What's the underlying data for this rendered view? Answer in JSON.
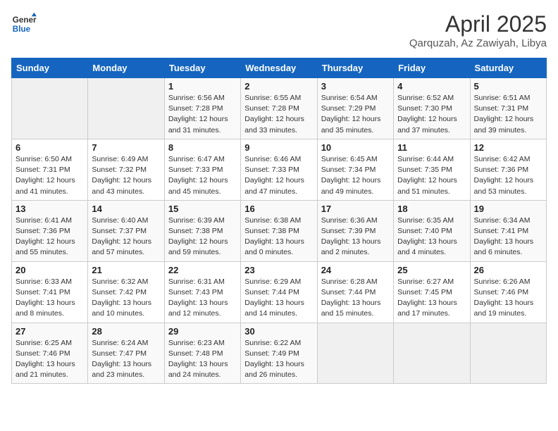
{
  "header": {
    "logo_general": "General",
    "logo_blue": "Blue",
    "title": "April 2025",
    "location": "Qarquzah, Az Zawiyah, Libya"
  },
  "days_of_week": [
    "Sunday",
    "Monday",
    "Tuesday",
    "Wednesday",
    "Thursday",
    "Friday",
    "Saturday"
  ],
  "weeks": [
    [
      {
        "day": "",
        "info": ""
      },
      {
        "day": "",
        "info": ""
      },
      {
        "day": "1",
        "info": "Sunrise: 6:56 AM\nSunset: 7:28 PM\nDaylight: 12 hours and 31 minutes."
      },
      {
        "day": "2",
        "info": "Sunrise: 6:55 AM\nSunset: 7:28 PM\nDaylight: 12 hours and 33 minutes."
      },
      {
        "day": "3",
        "info": "Sunrise: 6:54 AM\nSunset: 7:29 PM\nDaylight: 12 hours and 35 minutes."
      },
      {
        "day": "4",
        "info": "Sunrise: 6:52 AM\nSunset: 7:30 PM\nDaylight: 12 hours and 37 minutes."
      },
      {
        "day": "5",
        "info": "Sunrise: 6:51 AM\nSunset: 7:31 PM\nDaylight: 12 hours and 39 minutes."
      }
    ],
    [
      {
        "day": "6",
        "info": "Sunrise: 6:50 AM\nSunset: 7:31 PM\nDaylight: 12 hours and 41 minutes."
      },
      {
        "day": "7",
        "info": "Sunrise: 6:49 AM\nSunset: 7:32 PM\nDaylight: 12 hours and 43 minutes."
      },
      {
        "day": "8",
        "info": "Sunrise: 6:47 AM\nSunset: 7:33 PM\nDaylight: 12 hours and 45 minutes."
      },
      {
        "day": "9",
        "info": "Sunrise: 6:46 AM\nSunset: 7:33 PM\nDaylight: 12 hours and 47 minutes."
      },
      {
        "day": "10",
        "info": "Sunrise: 6:45 AM\nSunset: 7:34 PM\nDaylight: 12 hours and 49 minutes."
      },
      {
        "day": "11",
        "info": "Sunrise: 6:44 AM\nSunset: 7:35 PM\nDaylight: 12 hours and 51 minutes."
      },
      {
        "day": "12",
        "info": "Sunrise: 6:42 AM\nSunset: 7:36 PM\nDaylight: 12 hours and 53 minutes."
      }
    ],
    [
      {
        "day": "13",
        "info": "Sunrise: 6:41 AM\nSunset: 7:36 PM\nDaylight: 12 hours and 55 minutes."
      },
      {
        "day": "14",
        "info": "Sunrise: 6:40 AM\nSunset: 7:37 PM\nDaylight: 12 hours and 57 minutes."
      },
      {
        "day": "15",
        "info": "Sunrise: 6:39 AM\nSunset: 7:38 PM\nDaylight: 12 hours and 59 minutes."
      },
      {
        "day": "16",
        "info": "Sunrise: 6:38 AM\nSunset: 7:38 PM\nDaylight: 13 hours and 0 minutes."
      },
      {
        "day": "17",
        "info": "Sunrise: 6:36 AM\nSunset: 7:39 PM\nDaylight: 13 hours and 2 minutes."
      },
      {
        "day": "18",
        "info": "Sunrise: 6:35 AM\nSunset: 7:40 PM\nDaylight: 13 hours and 4 minutes."
      },
      {
        "day": "19",
        "info": "Sunrise: 6:34 AM\nSunset: 7:41 PM\nDaylight: 13 hours and 6 minutes."
      }
    ],
    [
      {
        "day": "20",
        "info": "Sunrise: 6:33 AM\nSunset: 7:41 PM\nDaylight: 13 hours and 8 minutes."
      },
      {
        "day": "21",
        "info": "Sunrise: 6:32 AM\nSunset: 7:42 PM\nDaylight: 13 hours and 10 minutes."
      },
      {
        "day": "22",
        "info": "Sunrise: 6:31 AM\nSunset: 7:43 PM\nDaylight: 13 hours and 12 minutes."
      },
      {
        "day": "23",
        "info": "Sunrise: 6:29 AM\nSunset: 7:44 PM\nDaylight: 13 hours and 14 minutes."
      },
      {
        "day": "24",
        "info": "Sunrise: 6:28 AM\nSunset: 7:44 PM\nDaylight: 13 hours and 15 minutes."
      },
      {
        "day": "25",
        "info": "Sunrise: 6:27 AM\nSunset: 7:45 PM\nDaylight: 13 hours and 17 minutes."
      },
      {
        "day": "26",
        "info": "Sunrise: 6:26 AM\nSunset: 7:46 PM\nDaylight: 13 hours and 19 minutes."
      }
    ],
    [
      {
        "day": "27",
        "info": "Sunrise: 6:25 AM\nSunset: 7:46 PM\nDaylight: 13 hours and 21 minutes."
      },
      {
        "day": "28",
        "info": "Sunrise: 6:24 AM\nSunset: 7:47 PM\nDaylight: 13 hours and 23 minutes."
      },
      {
        "day": "29",
        "info": "Sunrise: 6:23 AM\nSunset: 7:48 PM\nDaylight: 13 hours and 24 minutes."
      },
      {
        "day": "30",
        "info": "Sunrise: 6:22 AM\nSunset: 7:49 PM\nDaylight: 13 hours and 26 minutes."
      },
      {
        "day": "",
        "info": ""
      },
      {
        "day": "",
        "info": ""
      },
      {
        "day": "",
        "info": ""
      }
    ]
  ]
}
